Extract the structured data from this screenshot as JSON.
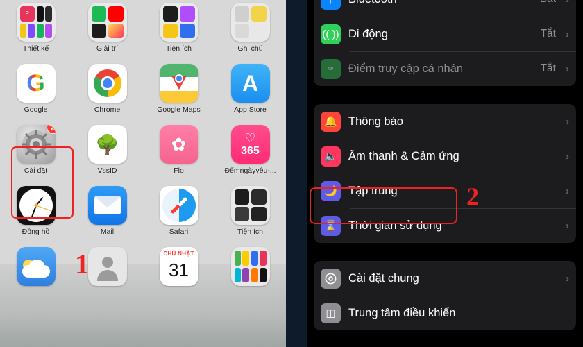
{
  "home_screen": {
    "apps": [
      {
        "label": "Thiết kế",
        "type": "folder",
        "badge": null
      },
      {
        "label": "Giải trí",
        "type": "folder",
        "badge": null
      },
      {
        "label": "Tiện ích",
        "type": "folder",
        "badge": null
      },
      {
        "label": "Ghi chú",
        "type": "folder",
        "badge": null
      },
      {
        "label": "Google",
        "type": "google",
        "badge": null
      },
      {
        "label": "Chrome",
        "type": "chrome",
        "badge": null
      },
      {
        "label": "Google Maps",
        "type": "maps",
        "badge": null
      },
      {
        "label": "App Store",
        "type": "appstore",
        "badge": null
      },
      {
        "label": "Cài đặt",
        "type": "settings",
        "badge": "2"
      },
      {
        "label": "VssID",
        "type": "vssid",
        "badge": null
      },
      {
        "label": "Flo",
        "type": "flo",
        "badge": null
      },
      {
        "label": "Đếmngàyyêu-...",
        "type": "d365",
        "badge": null
      },
      {
        "label": "Đồng hồ",
        "type": "clock",
        "badge": null
      },
      {
        "label": "Mail",
        "type": "mail",
        "badge": null
      },
      {
        "label": "Safari",
        "type": "safari",
        "badge": null
      },
      {
        "label": "Tiện ích",
        "type": "folder2",
        "badge": null
      },
      {
        "label": "",
        "type": "weather",
        "badge": null
      },
      {
        "label": "",
        "type": "contacts",
        "badge": null
      },
      {
        "label": "",
        "type": "calendar",
        "badge": null,
        "cal_top": "CHỦ NHẬT",
        "cal_day": "31"
      },
      {
        "label": "",
        "type": "folder3",
        "badge": null
      }
    ],
    "annotations": [
      {
        "number": "1",
        "target": "settings-app-icon"
      }
    ]
  },
  "settings_screen": {
    "groups": [
      {
        "rows": [
          {
            "icon": "bluetooth-icon",
            "title": "Bluetooth",
            "value": "Bật",
            "chevron": true,
            "dim": false
          },
          {
            "icon": "cellular-icon",
            "title": "Di động",
            "value": "Tắt",
            "chevron": true,
            "dim": false
          },
          {
            "icon": "hotspot-icon",
            "title": "Điểm truy cập cá nhân",
            "value": "Tắt",
            "chevron": true,
            "dim": true
          }
        ]
      },
      {
        "rows": [
          {
            "icon": "notifications-icon",
            "title": "Thông báo",
            "value": "",
            "chevron": true,
            "dim": false
          },
          {
            "icon": "sound-haptics-icon",
            "title": "Âm thanh & Cảm ứng",
            "value": "",
            "chevron": true,
            "dim": false
          },
          {
            "icon": "focus-icon",
            "title": "Tập trung",
            "value": "",
            "chevron": true,
            "dim": false
          },
          {
            "icon": "screen-time-icon",
            "title": "Thời gian sử dụng",
            "value": "",
            "chevron": true,
            "dim": false
          }
        ]
      },
      {
        "rows": [
          {
            "icon": "general-icon",
            "title": "Cài đặt chung",
            "value": "",
            "chevron": true,
            "dim": false
          },
          {
            "icon": "control-center-icon",
            "title": "Trung tâm điều khiển",
            "value": "",
            "chevron": false,
            "dim": false
          }
        ]
      }
    ],
    "annotations": [
      {
        "number": "2",
        "target": "focus-row"
      }
    ]
  },
  "colors": {
    "accent_red": "#ef2222",
    "badge_red": "#ff3b30",
    "row_bg": "#1c1c1e",
    "value_gray": "#8e8e93",
    "blue": "#0a84ff",
    "green": "#30d158",
    "purple": "#5e5ce6"
  }
}
